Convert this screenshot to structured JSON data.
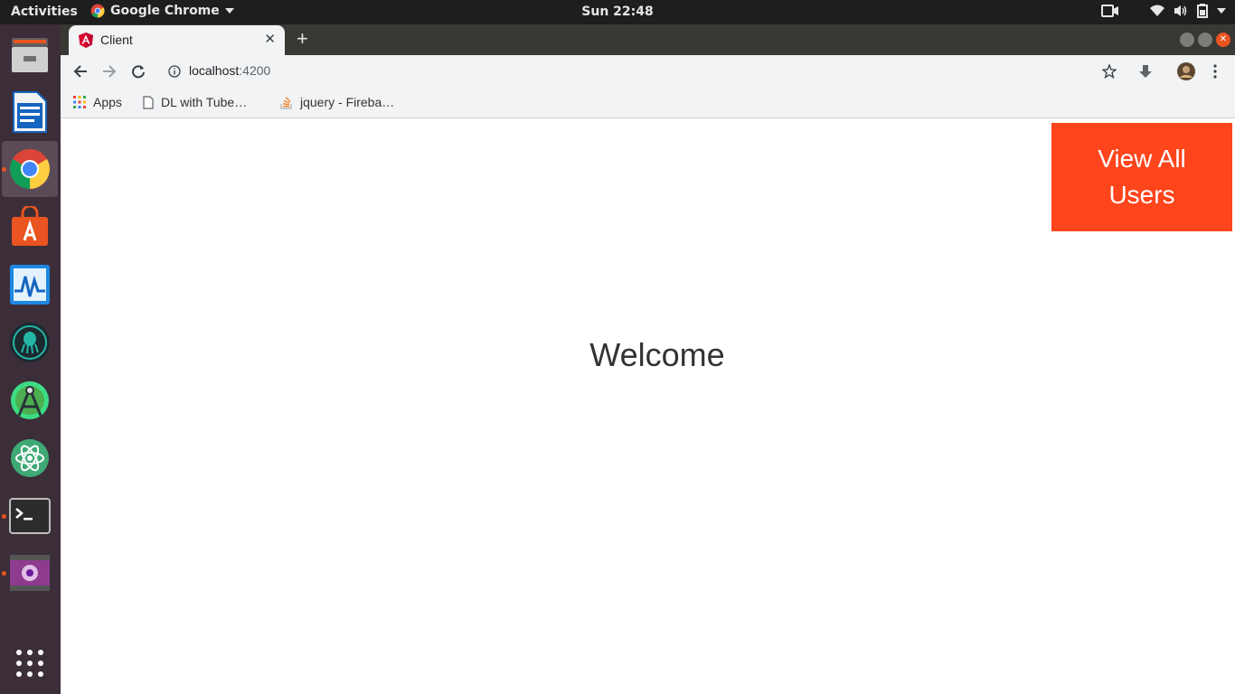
{
  "topbar": {
    "activities": "Activities",
    "app_name": "Google Chrome",
    "clock": "Sun 22:48"
  },
  "dock": {
    "items": [
      {
        "name": "Files",
        "icon": "file-cabinet-icon"
      },
      {
        "name": "LibreOffice Writer",
        "icon": "document-icon"
      },
      {
        "name": "Google Chrome",
        "icon": "chrome-icon"
      },
      {
        "name": "Ubuntu Software",
        "icon": "shopping-bag-icon"
      },
      {
        "name": "System Monitor",
        "icon": "pulse-icon"
      },
      {
        "name": "GitKraken",
        "icon": "kraken-icon"
      },
      {
        "name": "Android Studio",
        "icon": "android-studio-icon"
      },
      {
        "name": "Atom",
        "icon": "atom-icon"
      },
      {
        "name": "Terminal",
        "icon": "terminal-icon"
      },
      {
        "name": "Video",
        "icon": "video-icon"
      }
    ],
    "show_apps_icon": "grid-icon"
  },
  "browser": {
    "tab_title": "Client",
    "url_host": "localhost",
    "url_port": ":4200",
    "bookmarks": [
      "Apps",
      "DL with Tube…",
      "jquery - Fireba…"
    ]
  },
  "page": {
    "button_label": "View All Users",
    "heading": "Welcome"
  },
  "colors": {
    "accent_button": "#ff451c",
    "dock_bg": "#3b2e39",
    "ubuntu_orange": "#e95420"
  }
}
